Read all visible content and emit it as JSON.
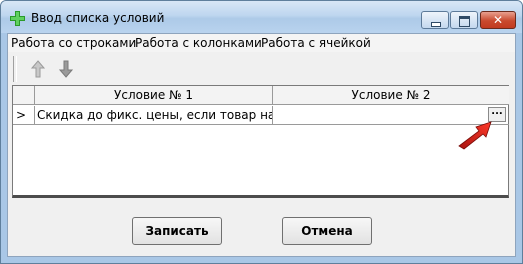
{
  "window": {
    "title": "Ввод списка условий",
    "controls": {
      "minimize": "minimize",
      "maximize": "maximize",
      "close": "✕"
    }
  },
  "menu": {
    "items": [
      {
        "label": "Работа со строками"
      },
      {
        "label": "Работа с колонками"
      },
      {
        "label": "Работа с ячейкой"
      }
    ]
  },
  "toolbar": {
    "buttons": [
      {
        "icon": "move-up-icon"
      },
      {
        "icon": "move-down-icon"
      }
    ]
  },
  "grid": {
    "columns": [
      "Условие № 1",
      "Условие № 2"
    ],
    "rows": [
      {
        "indicator": ">",
        "cells": [
          "Скидка до фикс. цены, если товар находи",
          ""
        ],
        "ellipsis": "..."
      }
    ]
  },
  "buttons": {
    "save": "Записать",
    "cancel": "Отмена"
  },
  "colors": {
    "annotation_arrow": "#e0201a",
    "title_bar": "#bed6ef",
    "close_button": "#c94a2e"
  }
}
